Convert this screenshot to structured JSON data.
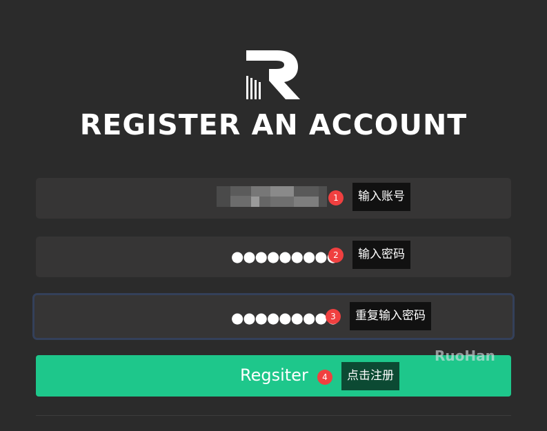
{
  "header": {
    "logo_letter": "R",
    "title": "REGISTER AN ACCOUNT"
  },
  "form": {
    "username": {
      "value": "",
      "masked": true,
      "marker": "1",
      "tooltip": "输入账号"
    },
    "password": {
      "value": "●●●●●●●●●",
      "marker": "2",
      "tooltip": "输入密码"
    },
    "confirm_password": {
      "value": "●●●●●●●●●",
      "marker": "3",
      "tooltip": "重复输入密码"
    },
    "register_button": {
      "label": "Regsiter",
      "marker": "4",
      "tooltip": "点击注册"
    }
  },
  "watermark": "RuoHan",
  "colors": {
    "background": "#2b2b2b",
    "field": "#363535",
    "focus_border": "#34405a",
    "button": "#1ec78b",
    "marker": "#f04040",
    "tooltip": "#111111"
  }
}
